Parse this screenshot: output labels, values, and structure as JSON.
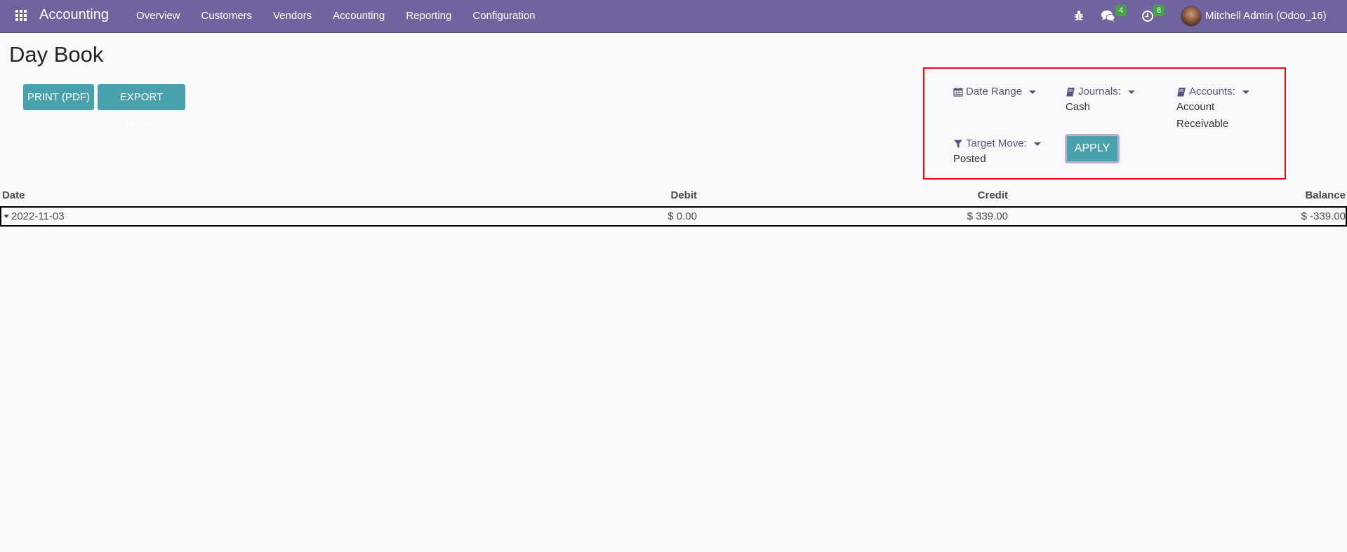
{
  "navbar": {
    "app_name": "Accounting",
    "menu": [
      "Overview",
      "Customers",
      "Vendors",
      "Accounting",
      "Reporting",
      "Configuration"
    ],
    "messages_count": "4",
    "activities_count": "8",
    "user_name": "Mitchell Admin (Odoo_16)",
    "background_color": "#71639e",
    "badge_color": "#4aa04a"
  },
  "page": {
    "title": "Day Book",
    "print_label": "PRINT (PDF)",
    "export_label": "EXPORT (XLSX)",
    "button_color": "#4aa1ae"
  },
  "filters": {
    "date_range_label": "Date Range",
    "journals_label": "Journals:",
    "journals_value": "Cash",
    "accounts_label": "Accounts:",
    "accounts_value_line1": "Account",
    "accounts_value_line2": "Receivable",
    "target_move_label": "Target Move:",
    "target_move_value": "Posted",
    "apply_label": "APPLY",
    "highlight_color": "#ff0000"
  },
  "table": {
    "columns": [
      "Date",
      "Debit",
      "Credit",
      "Balance"
    ],
    "rows": [
      {
        "date": "2022-11-03",
        "debit": "$ 0.00",
        "credit": "$ 339.00",
        "balance": "$ -339.00"
      }
    ]
  }
}
